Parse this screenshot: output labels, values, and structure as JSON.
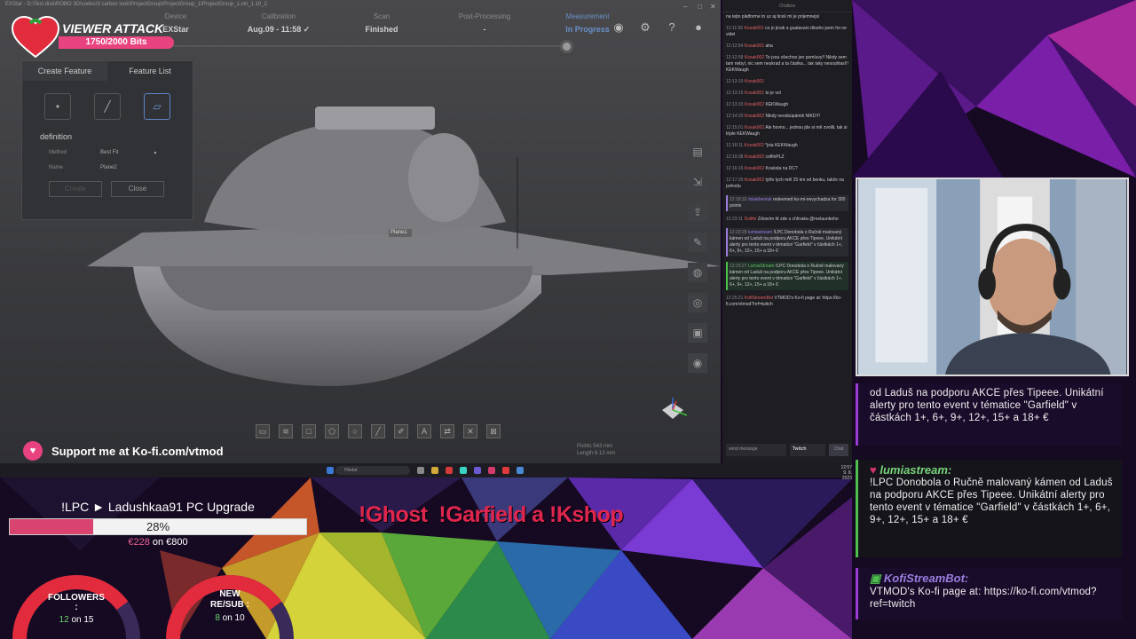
{
  "app": {
    "title": "EXStar - D:\\Test disk\\ROBO 3D\\codes\\3 carbon look\\ProjectGroup\\ProjectGroup_1\\ProjectGroup_1.sln_1.10_2",
    "steps": [
      {
        "label": "Device",
        "value": "EXStar"
      },
      {
        "label": "Calibration",
        "value": "Aug.09 - 11:58 ✓"
      },
      {
        "label": "Scan",
        "value": "Finished"
      },
      {
        "label": "Post-Processing",
        "value": "-"
      },
      {
        "label": "Measurement",
        "value": "In Progress"
      }
    ],
    "window_buttons": [
      "–",
      "□",
      "✕"
    ],
    "feature_panel": {
      "tabs": [
        "Create Feature",
        "Feature List"
      ],
      "section": "definition",
      "method_label": "Method",
      "method_value": "Best Fit",
      "name_label": "Name",
      "name_value": "Plane2",
      "create_button": "Create",
      "close_button": "Close"
    },
    "plane_label": "Plane1",
    "coords": [
      "Points 543 mm",
      "Length 6.12 mm"
    ]
  },
  "viewer_attack": {
    "title": "VIEWER ATTACK",
    "progress": "1750/2000 Bits"
  },
  "kofi": {
    "text": "Support me at Ko-fi.com/vtmod"
  },
  "taskbar": {
    "search": "Hledat",
    "time": "12:57",
    "date": "9. 8. 2023"
  },
  "chat": {
    "header": "Chatbox",
    "messages": [
      {
        "time": "",
        "user": "",
        "text": "na tejto platforme to uz aj ticek mi je prijemnejsi",
        "style": ""
      },
      {
        "time": "12:11:56",
        "user": "Kosak001",
        "text": "co jo jinak a guatavani dlouho jsem ho ne videl",
        "style": ""
      },
      {
        "time": "12:12:54",
        "user": "Kosak001",
        "text": "aha",
        "style": ""
      },
      {
        "time": "12:12:58",
        "user": "Kosak002",
        "text": "To jsou všechno jen pomluvy!! Nikdy sem tam nebyl, nic sem neukrad a ta částka... tak taky nesouhlasí!! KEKWaugh",
        "style": ""
      },
      {
        "time": "12:13:10",
        "user": "Kosak001",
        "text": "",
        "style": ""
      },
      {
        "time": "12:13:15",
        "user": "Kosak001",
        "text": "to je vol",
        "style": ""
      },
      {
        "time": "12:13:33",
        "user": "Kosak002",
        "text": "KEKWaugh",
        "style": ""
      },
      {
        "time": "12:14:20",
        "user": "Kosak002",
        "text": "Nikdy neodsúpámiš NIKDY!",
        "style": ""
      },
      {
        "time": "12:15:01",
        "user": "Kosak002",
        "text": "Ale hovno... jednou jde si mě zvolili, tak si triple KEKWaugh",
        "style": ""
      },
      {
        "time": "12:18:11",
        "user": "Kosak002",
        "text": "*jsia KEKWaugh",
        "style": ""
      },
      {
        "time": "12:19:38",
        "user": "Kosak002",
        "text": "coffinPLZ",
        "style": ""
      },
      {
        "time": "12:16:16",
        "user": "Kosak002",
        "text": "Kouksla na DC?",
        "style": ""
      },
      {
        "time": "12:17:25",
        "user": "Kosak002",
        "text": "tytře tych měl 25 km od benku, takže na pohodu",
        "style": ""
      },
      {
        "time": "12:18:33",
        "user": "dolakbeniak",
        "text": "redeemed ko-mi-nevychadza for 300 points",
        "style": "hl"
      },
      {
        "time": "12:23:11",
        "user": "Dolifie",
        "text": "Zdravím tě zde u chlivaka @melaunbohe",
        "style": ""
      },
      {
        "time": "12:23:28",
        "user": "lumiastream",
        "text": "!LPC Donobola o Ručně malovaný kámen od Laduš na podporu AKCE přes Tipeee. Unikátní alerty pro tento event v tématice \"Garfield\" v částkách 1+, 6+, 9+, 12+, 15+ a 18+ €",
        "style": "hl"
      },
      {
        "time": "12:23:27",
        "user": "LumiaStream",
        "text": "!LPC Donobola o Ručně malovaný kámen od Laduš na podporu AKCE přes Tipeee. Unikátní alerty pro tento event v tématice \"Garfield\" v částkách 1+, 6+, 9+, 12+, 15+ a 18+ €",
        "style": "hlg"
      },
      {
        "time": "12:25:21",
        "user": "KofiStreamBot",
        "text": "VTMOD's Ko-fi page at: https://ko-fi.com/vtmod?ref=twitch",
        "style": ""
      }
    ],
    "input_placeholder": "send message",
    "platform": "Twitch",
    "send_label": "Chat"
  },
  "overlay_chat": {
    "top_fragment": "od Laduš na podporu AKCE přes Tipeee. Unikátní alerty pro tento event v tématice \"Garfield\" v částkách 1+, 6+, 9+, 12+, 15+ a 18+ €",
    "lumia_name": "lumiastream:",
    "lumia_text": "!LPC Donobola o Ručně malovaný kámen od Laduš na podporu AKCE přes Tipeee. Unikátní alerty pro tento event v tématice \"Garfield\" v částkách 1+, 6+, 9+, 12+, 15+ a 18+ €",
    "kofi_name": "KofiStreamBot:",
    "kofi_text": "VTMOD's Ko-fi page at: https://ko-fi.com/vtmod?ref=twitch"
  },
  "goal": {
    "title": "!LPC ► Ladushkaa91 PC Upgrade",
    "percent": "28%",
    "fraction": 0.28,
    "current": "€228",
    "rest": "on €800"
  },
  "followers": {
    "label": "FOLLOWERS",
    "sep": ":",
    "current": "12",
    "rest": "on 15",
    "fraction": 0.8
  },
  "subs": {
    "label1": "NEW",
    "label2": "RE/SUB :",
    "current": "8",
    "rest": "on 10",
    "fraction": 0.8
  },
  "commands": {
    "text": "!Ghost  !Garfield a !Kshop"
  },
  "colors": {
    "accent": "#e9437f",
    "measure_blue": "#6a8fc8",
    "command_red": "#e0264f"
  }
}
